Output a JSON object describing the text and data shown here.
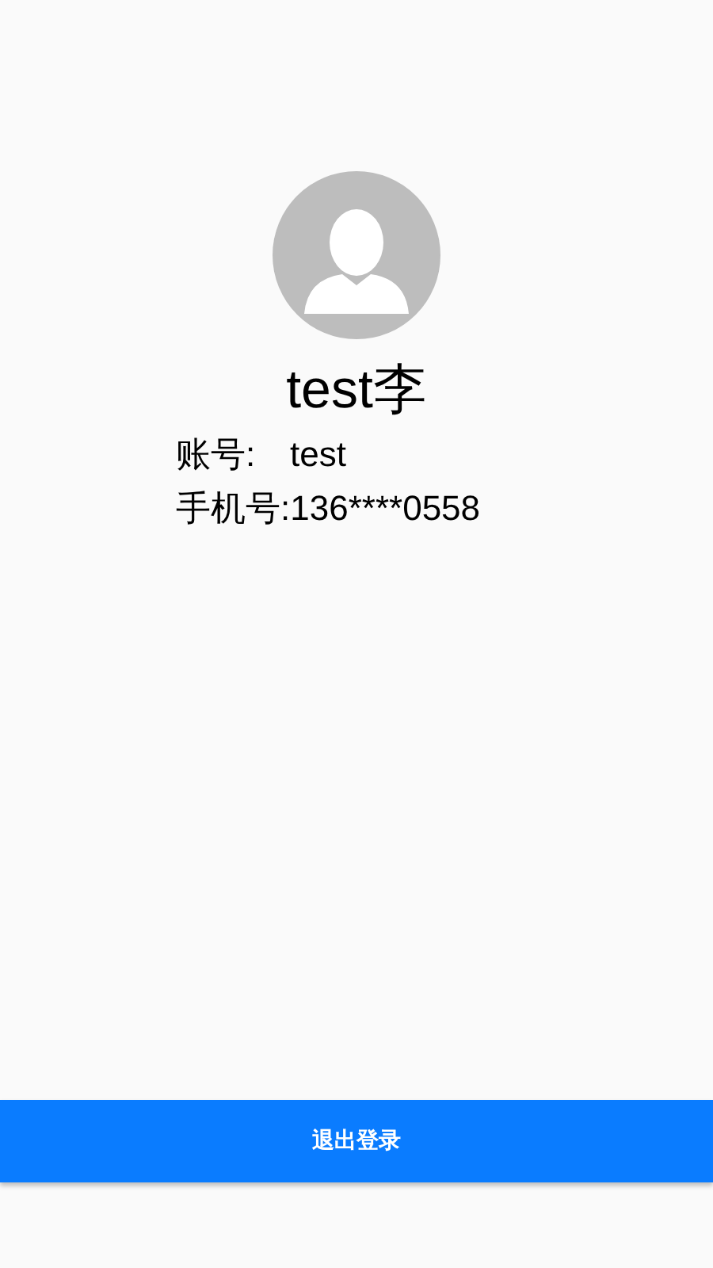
{
  "profile": {
    "name": "test李",
    "fields": [
      {
        "label": "账号:",
        "value": "test"
      },
      {
        "label": "手机号:",
        "value": "136****0558"
      }
    ]
  },
  "logout_button": {
    "label": "退出登录"
  }
}
